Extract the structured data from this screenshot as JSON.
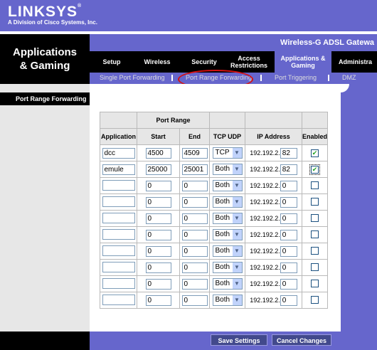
{
  "header": {
    "brand": "LINKSYS",
    "registered": "®",
    "subtitle": "A Division of Cisco Systems, Inc.",
    "section_title_line1": "Applications",
    "section_title_line2": "& Gaming",
    "product_name": "Wireless-G ADSL Gatewa"
  },
  "tabs": [
    {
      "label": "Setup"
    },
    {
      "label": "Wireless"
    },
    {
      "label": "Security"
    },
    {
      "label": "Access Restrictions"
    },
    {
      "label": "Applications & Gaming"
    },
    {
      "label": "Administra"
    }
  ],
  "subtabs": [
    {
      "label": "Single Port Forwarding"
    },
    {
      "label": "Port Range Forwarding"
    },
    {
      "label": "Port Triggering"
    },
    {
      "label": "DMZ"
    }
  ],
  "side_section": "Port Range Forwarding",
  "table": {
    "group_header": "Port Range",
    "columns": [
      "Application",
      "Start",
      "End",
      "TCP  UDP",
      "IP Address",
      "Enabled"
    ],
    "ip_prefix": "192.192.2.",
    "rows": [
      {
        "application": "dcc",
        "start": "4500",
        "end": "4509",
        "protocol": "TCP",
        "ip_last": "82",
        "enabled": true
      },
      {
        "application": "emule",
        "start": "25000",
        "end": "25001",
        "protocol": "Both",
        "ip_last": "82",
        "enabled": true
      },
      {
        "application": "",
        "start": "0",
        "end": "0",
        "protocol": "Both",
        "ip_last": "0",
        "enabled": false
      },
      {
        "application": "",
        "start": "0",
        "end": "0",
        "protocol": "Both",
        "ip_last": "0",
        "enabled": false
      },
      {
        "application": "",
        "start": "0",
        "end": "0",
        "protocol": "Both",
        "ip_last": "0",
        "enabled": false
      },
      {
        "application": "",
        "start": "0",
        "end": "0",
        "protocol": "Both",
        "ip_last": "0",
        "enabled": false
      },
      {
        "application": "",
        "start": "0",
        "end": "0",
        "protocol": "Both",
        "ip_last": "0",
        "enabled": false
      },
      {
        "application": "",
        "start": "0",
        "end": "0",
        "protocol": "Both",
        "ip_last": "0",
        "enabled": false
      },
      {
        "application": "",
        "start": "0",
        "end": "0",
        "protocol": "Both",
        "ip_last": "0",
        "enabled": false
      },
      {
        "application": "",
        "start": "0",
        "end": "0",
        "protocol": "Both",
        "ip_last": "0",
        "enabled": false
      }
    ]
  },
  "buttons": {
    "save": "Save Settings",
    "cancel": "Cancel Changes"
  },
  "colors": {
    "brand_purple": "#6666cc",
    "highlight_red": "#d61010",
    "button": "#42498c"
  }
}
